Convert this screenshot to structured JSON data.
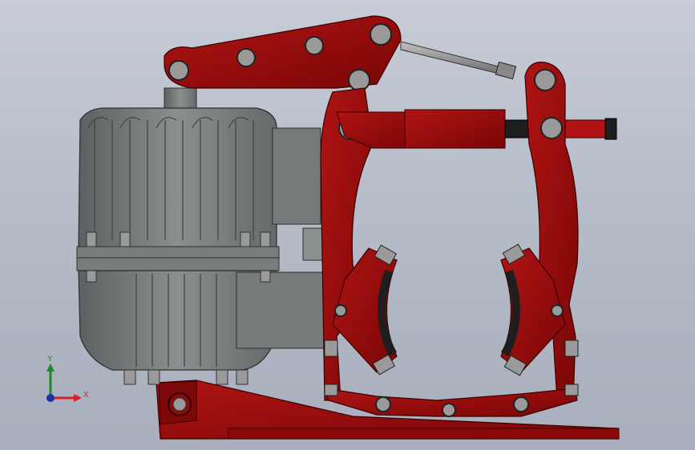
{
  "scene": {
    "description_type": "cad-model-viewport",
    "colors": {
      "background_top": "#c7ccd6",
      "background_bottom": "#a8aebb",
      "brake_red": "#8f0a0a",
      "brake_red_light": "#b01414",
      "motor_gray": "#6d7372",
      "motor_gray_light": "#8a908f",
      "bolt_gray": "#9a9a9a",
      "pad_black": "#1e1e1e"
    }
  },
  "triad": {
    "x_label": "X",
    "y_label": "Y",
    "x_color": "#d0202a",
    "y_color": "#1a8a2a",
    "z_color": "#1d2fa8"
  }
}
